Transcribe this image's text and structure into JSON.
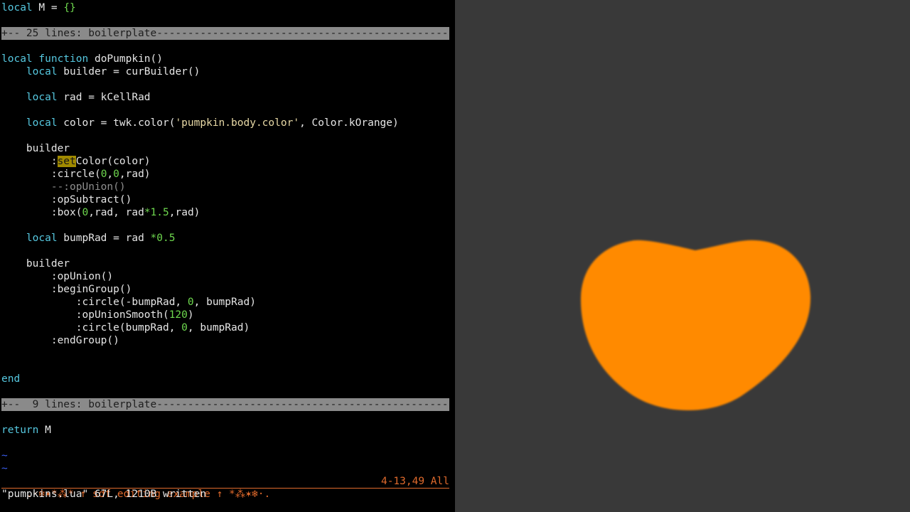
{
  "editor": {
    "line1": {
      "kw": "local",
      "mid": " M = ",
      "brace": "{}"
    },
    "fold1": "+-- 25 lines: boilerplate------------------------------------------------",
    "line_fn": {
      "kw1": "local",
      "kw2": " function",
      "rest": " doPumpkin()"
    },
    "line_builder": {
      "indent": "    ",
      "kw": "local",
      "rest": " builder = curBuilder()"
    },
    "line_rad": {
      "indent": "    ",
      "kw": "local",
      "rest": " rad = kCellRad"
    },
    "line_color": {
      "indent": "    ",
      "kw": "local",
      "pre": " color = twk.color(",
      "str": "'pumpkin.body.color'",
      "post": ", Color.kOrange)"
    },
    "line_b1": "    builder",
    "line_setcolor": {
      "indent": "        :",
      "hl": "set",
      "rest": "Color(color)"
    },
    "line_circle": {
      "pre": "        :circle(",
      "n1": "0",
      "c1": ",",
      "n2": "0",
      "post": ",rad)"
    },
    "line_comment": "        --:opUnion()",
    "line_subtract": "        :opSubtract()",
    "line_box": {
      "pre": "        :box(",
      "n1": "0",
      "mid": ",rad, rad",
      "op": "*",
      "n2": "1.5",
      "post": ",rad)"
    },
    "line_bump": {
      "indent": "    ",
      "kw": "local",
      "pre": " bumpRad = rad ",
      "op": "*",
      "num": "0.5"
    },
    "line_b2": "    builder",
    "line_union": "        :opUnion()",
    "line_begin": "        :beginGroup()",
    "line_circ_a": {
      "pre": "            :circle(-bumpRad, ",
      "num": "0",
      "post": ", bumpRad)"
    },
    "line_smooth": {
      "pre": "            :opUnionSmooth(",
      "num": "120",
      "post": ")"
    },
    "line_circ_b": {
      "pre": "            :circle(bumpRad, ",
      "num": "0",
      "post": ", bumpRad)"
    },
    "line_endgroup": "        :endGroup()",
    "line_end": "end",
    "fold2": "+--  9 lines: boilerplate--------------------------------------------------",
    "line_return": {
      "kw": "return",
      "rest": " M"
    },
    "tilde": "~"
  },
  "statusbar": {
    "left": ".·❄✶*⁂* ↑ sdf editing example ↑ *⁂✶❄·.",
    "right": "4-13,49 All"
  },
  "cmdline": "\"pumpkins.lua\" 67L, 1210B written",
  "preview": {
    "shape_color": "#ff8a00",
    "background": "#393939"
  }
}
